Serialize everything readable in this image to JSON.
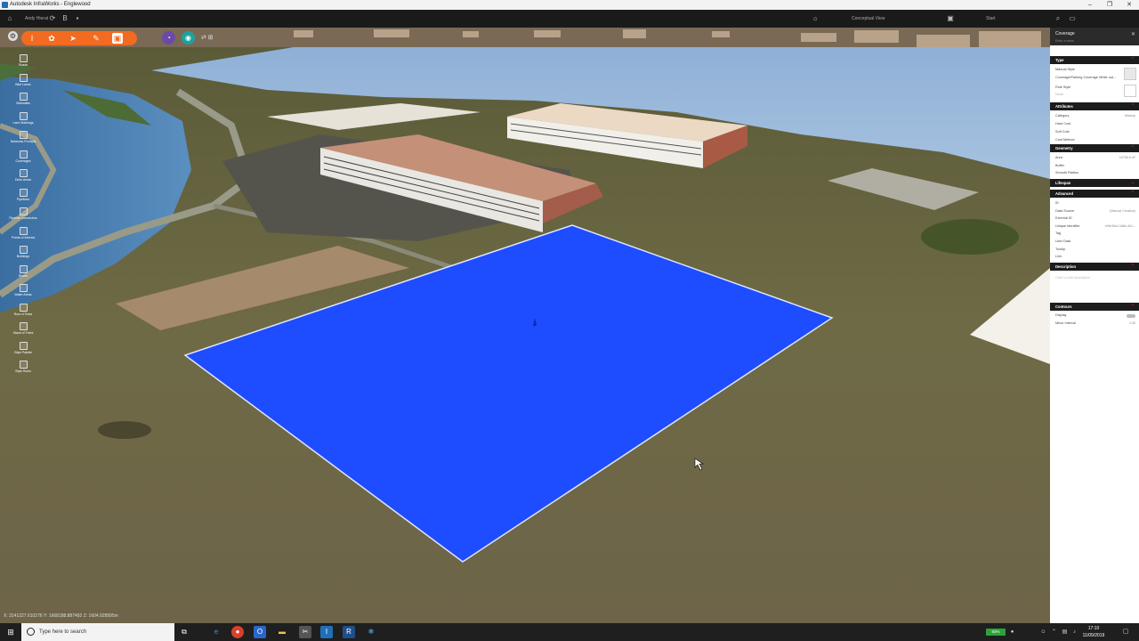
{
  "window": {
    "title": "Autodesk InfraWorks - Englewood",
    "minimize_icon": "minimize-icon",
    "maximize_icon": "restore-icon",
    "close_icon": "close-icon"
  },
  "appbar": {
    "user": "Andy Hierat",
    "center_label": "Conceptual View",
    "right_label": "Start"
  },
  "left_tools": [
    {
      "label": "Roads"
    },
    {
      "label": "Bike Lanes"
    },
    {
      "label": "Sidewalks"
    },
    {
      "label": "Lane Markings"
    },
    {
      "label": "Networks Prompts"
    },
    {
      "label": "Coverages"
    },
    {
      "label": "Drive Areas"
    },
    {
      "label": "Pipelines"
    },
    {
      "label": "Pipeline Connectors"
    },
    {
      "label": "Points of Interest"
    },
    {
      "label": "Buildings"
    },
    {
      "label": "Rivers"
    },
    {
      "label": "Water Areas"
    },
    {
      "label": "Row of Trees"
    },
    {
      "label": "Stand of Trees"
    },
    {
      "label": "Style Palette"
    },
    {
      "label": "Style Rules"
    }
  ],
  "toolbar": {
    "colors": {
      "accent": "#f26b21",
      "purple": "#6a4aa8",
      "teal": "#1da2a0"
    }
  },
  "coords": "X: 3141227.610276  Y: 1668188.887492  Z: 1604.928995m",
  "panel": {
    "title": "Coverage",
    "subtitle": "Enter a name",
    "sections": {
      "type": "Type",
      "attributes": "Attributes",
      "geometry": "Geometry",
      "lifespan": "Lifespan",
      "advanced": "Advanced",
      "description": "Description",
      "contours": "Contours"
    },
    "type_props": {
      "manual_style_label": "Manual Style",
      "manual_style_value": "Coverage/Parking Coverage White out...",
      "rule_style_label": "Rule Style",
      "rule_style_value": "None"
    },
    "attributes": [
      {
        "label": "Category",
        "value": "Markup"
      },
      {
        "label": "Hard Cost",
        "value": ""
      },
      {
        "label": "Soft Cost",
        "value": ""
      },
      {
        "label": "Cost Method",
        "value": ""
      }
    ],
    "geometry": [
      {
        "label": "Area",
        "value": "10756.8 m²"
      },
      {
        "label": "Buffer",
        "value": ""
      },
      {
        "label": "Smooth Radius",
        "value": ""
      }
    ],
    "advanced": [
      {
        "label": "ID",
        "value": ""
      },
      {
        "label": "Data Source",
        "value": "(Manual Creation)"
      },
      {
        "label": "External ID",
        "value": ""
      },
      {
        "label": "Unique Identifier",
        "value": "e9b1f5c4-3d8e-4b1..."
      },
      {
        "label": "Tag",
        "value": ""
      },
      {
        "label": "User Data",
        "value": ""
      },
      {
        "label": "Tooltip",
        "value": ""
      },
      {
        "label": "Link",
        "value": ""
      }
    ],
    "description_placeholder": "Click to edit description",
    "contours": [
      {
        "label": "Display",
        "value": ""
      },
      {
        "label": "Minor Interval",
        "value": "1.00"
      }
    ]
  },
  "taskbar": {
    "search_placeholder": "Type here to search",
    "battery": "93%",
    "time": "17:10",
    "date": "11/09/2019"
  }
}
